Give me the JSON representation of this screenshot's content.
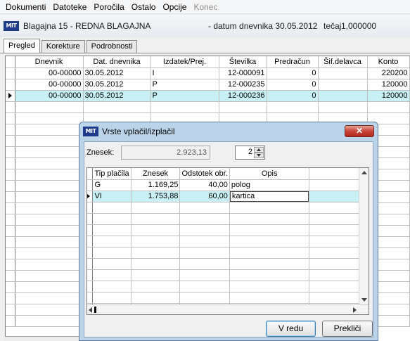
{
  "menu": {
    "items": [
      "Dokumenti",
      "Datoteke",
      "Poročila",
      "Ostalo",
      "Opcije"
    ],
    "disabled_item": "Konec"
  },
  "header": {
    "logo": "MIT",
    "title": "Blagajna 15  - REDNA BLAGAJNA",
    "date_text": "- datum dnevnika 30.05.2012",
    "rate_label": "tečaj",
    "rate_value": "1,000000"
  },
  "tabs": [
    "Pregled",
    "Korekture",
    "Podrobnosti"
  ],
  "main_grid": {
    "columns": [
      "Dnevnik",
      "Dat. dnevnika",
      "Izdatek/Prej.",
      "Številka",
      "Predračun",
      "Šif.delavca",
      "Konto"
    ],
    "rows": [
      [
        "00-00000",
        "30.05.2012",
        "I",
        "12-000091",
        "0",
        "",
        "220200"
      ],
      [
        "00-00000",
        "30.05.2012",
        "P",
        "12-000235",
        "0",
        "",
        "120000"
      ],
      [
        "00-00000",
        "30.05.2012",
        "P",
        "12-000236",
        "0",
        "",
        "120000"
      ]
    ],
    "selected_row": 2
  },
  "dialog": {
    "logo": "MIT",
    "title": "Vrste vplačil/izplačil",
    "close_label": "✕",
    "amount_label": "Znesek:",
    "amount_value": "2.923,13",
    "spinner_value": "2",
    "grid": {
      "columns": [
        "Tip plačila",
        "Znesek",
        "Odstotek obr.",
        "Opis"
      ],
      "rows": [
        [
          "G",
          "1.169,25",
          "40,00",
          "polog"
        ],
        [
          "VI",
          "1.753,88",
          "60,00",
          "kartica"
        ]
      ]
    },
    "ok_label": "V redu",
    "cancel_label": "Prekliči"
  },
  "colors": {
    "selection": "#c9f0f5",
    "dialog_frame": "#bcd4ea",
    "close_button": "#c9453a"
  }
}
